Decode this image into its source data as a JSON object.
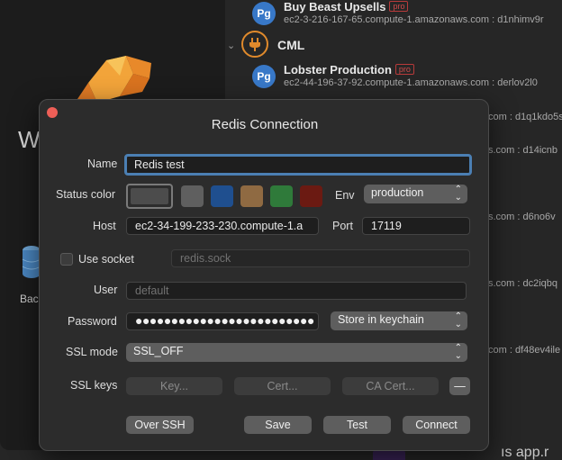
{
  "background": {
    "welcome_text": "We",
    "backup_text": "Bac",
    "connections": [
      {
        "name": "Buy Beast Upsells",
        "pro": "pro",
        "host": "ec2-3-216-167-65.compute-1.amazonaws.com : d1nhimv9r",
        "badge": "Pg"
      },
      {
        "name": "Lobster Production",
        "pro": "pro",
        "host": "ec2-44-196-37-92.compute-1.amazonaws.com : derlov2l0",
        "badge": "Pg"
      }
    ],
    "group": {
      "label": "CML",
      "chevron": "⌄",
      "icon": "plug-icon"
    },
    "peeks": [
      "com : d1q1kdo5s",
      "s.com : d14icnb",
      "s.com : d6no6v",
      "s.com : dc2iqbq",
      "com : df48ev4ile"
    ],
    "app_peek": "ıs  app.r"
  },
  "dialog": {
    "title": "Redis Connection",
    "name_label": "Name",
    "name_value": "Redis test",
    "status_color_label": "Status color",
    "status_colors": [
      "#4c4c4c",
      "#5f5f5f",
      "#1f4f8f",
      "#8f6a42",
      "#2f7a3a",
      "#6b1a12"
    ],
    "env_label": "Env",
    "env_value": "production",
    "host_label": "Host",
    "host_value": "ec2-34-199-233-230.compute-1.a",
    "port_label": "Port",
    "port_value": "17119",
    "use_socket_label": "Use socket",
    "socket_placeholder": "redis.sock",
    "user_label": "User",
    "user_placeholder": "default",
    "password_label": "Password",
    "password_value": "●●●●●●●●●●●●●●●●●●●●●●●●●",
    "password_store": "Store in keychain",
    "ssl_mode_label": "SSL mode",
    "ssl_mode_value": "SSL_OFF",
    "ssl_keys_label": "SSL keys",
    "key_button": "Key...",
    "cert_button": "Cert...",
    "ca_cert_button": "CA Cert...",
    "minus_button": "—",
    "over_ssh_button": "Over SSH",
    "save_button": "Save",
    "test_button": "Test",
    "connect_button": "Connect",
    "updown_glyph": "⌃⌄"
  }
}
